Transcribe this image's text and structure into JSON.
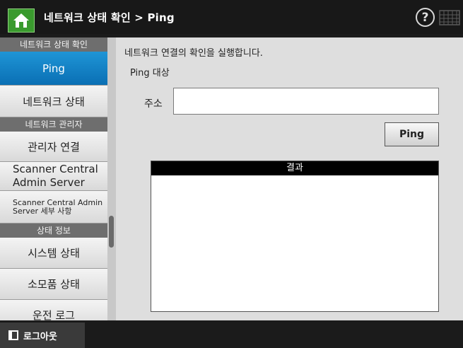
{
  "header": {
    "title": "네트워크 상태 확인 > Ping",
    "help_glyph": "?"
  },
  "sidebar": {
    "sections": [
      {
        "category": "네트워크 상태 확인",
        "items": [
          {
            "label": "Ping",
            "active": true
          },
          {
            "label": "네트워크 상태"
          }
        ]
      },
      {
        "category": "네트워크 관리자",
        "items": [
          {
            "label": "관리자 연결"
          },
          {
            "label": "Scanner Central Admin Server"
          },
          {
            "label": "Scanner Central Admin Server 세부 사항"
          }
        ]
      },
      {
        "category": "상태 정보",
        "items": [
          {
            "label": "시스템 상태"
          },
          {
            "label": "소모품 상태"
          },
          {
            "label": "운전 로그"
          }
        ]
      }
    ]
  },
  "main": {
    "description": "네트워크 연결의 확인을 실행합니다.",
    "target_label": "Ping 대상",
    "address_label": "주소",
    "address_value": "",
    "ping_button": "Ping",
    "result_header": "결과",
    "result_text": ""
  },
  "footer": {
    "logout_label": "로그아웃"
  }
}
